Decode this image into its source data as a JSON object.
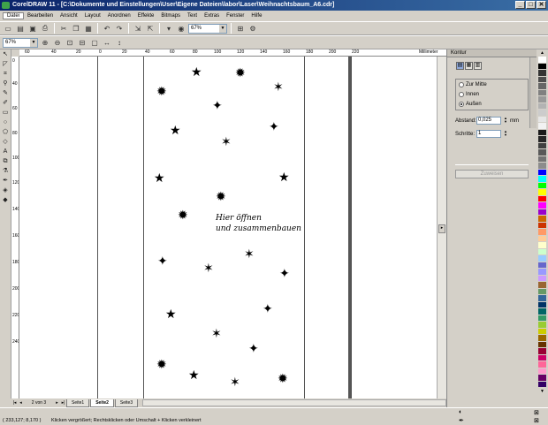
{
  "window": {
    "title": "CorelDRAW 11 - [C:\\Dokumente und Einstellungen\\User\\Eigene Dateien\\labor\\Laser\\Weihnachtsbaum_A6.cdr]",
    "controls": [
      "_",
      "□",
      "✕"
    ]
  },
  "menu": [
    "Datei",
    "Bearbeiten",
    "Ansicht",
    "Layout",
    "Anordnen",
    "Effekte",
    "Bitmaps",
    "Text",
    "Extras",
    "Fenster",
    "Hilfe"
  ],
  "toolbar": {
    "zoom_value": "67%",
    "zoom_value_2": "67%"
  },
  "ruler": {
    "unit": "Millimeter",
    "h_ticks": [
      "60",
      "40",
      "20",
      "0",
      "20",
      "40",
      "60",
      "80",
      "100",
      "120",
      "140",
      "160",
      "180",
      "200",
      "220"
    ],
    "v_ticks": [
      "0",
      "40",
      "60",
      "80",
      "100",
      "120",
      "140",
      "160",
      "180",
      "200",
      "220",
      "240"
    ]
  },
  "canvas": {
    "text_lines": [
      "Hier öffnen",
      "und zusammenbauen"
    ]
  },
  "pages": {
    "indicator": "2 von 3",
    "tabs": [
      "Seite1",
      "Seite2",
      "Seite3"
    ],
    "active": "Seite2"
  },
  "docker": {
    "title": "Kontur",
    "options": [
      "Zur Mitte",
      "Innen",
      "Außen"
    ],
    "selected_option": "Außen",
    "distance_label": "Abstand:",
    "distance_value": "0,025",
    "distance_unit": "mm",
    "steps_label": "Schritte:",
    "steps_value": "1",
    "apply_label": "Zuweisen"
  },
  "palette": [
    "#ffffff",
    "#000000",
    "#333333",
    "#4d4d4d",
    "#666666",
    "#808080",
    "#999999",
    "#b3b3b3",
    "#cccccc",
    "#e6e6e6",
    "#f2f2f2",
    "#1a1a1a",
    "#262626",
    "#404040",
    "#595959",
    "#737373",
    "#8c8c8c",
    "#0000ff",
    "#00ffff",
    "#00ff00",
    "#ffff00",
    "#ff0000",
    "#ff00ff",
    "#9900cc",
    "#cc6600",
    "#cc3300",
    "#ff9966",
    "#ffcc99",
    "#ffffcc",
    "#ccffcc",
    "#99ccff",
    "#6666cc",
    "#9999ff",
    "#cc99ff",
    "#996633",
    "#669966",
    "#336699",
    "#003366",
    "#006666",
    "#339966",
    "#99cc33",
    "#cccc00",
    "#996600",
    "#663300",
    "#990033",
    "#cc0066",
    "#ff6699",
    "#ff99cc",
    "#660066",
    "#330066"
  ],
  "status": {
    "coords": "( 233,127; 8,170 )",
    "hint": "Klicken vergrößert; Rechtsklicken oder Umschalt + Klicken verkleinert"
  }
}
